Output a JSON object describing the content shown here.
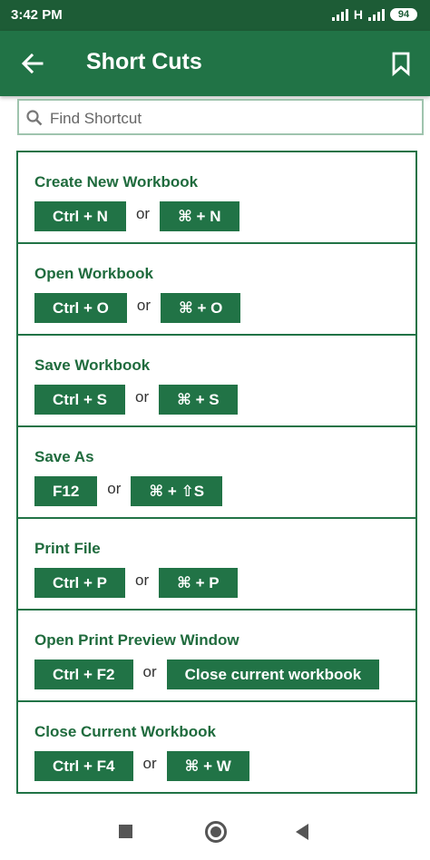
{
  "status": {
    "time": "3:42 PM",
    "network": "H",
    "battery": "94"
  },
  "header": {
    "title": "Short Cuts"
  },
  "search": {
    "placeholder": "Find Shortcut",
    "value": ""
  },
  "or_label": "or",
  "shortcuts": [
    {
      "label": "Create New Workbook",
      "keys": [
        "Ctrl + N",
        "⌘ + N"
      ]
    },
    {
      "label": "Open Workbook",
      "keys": [
        "Ctrl + O",
        "⌘ + O"
      ]
    },
    {
      "label": "Save Workbook",
      "keys": [
        "Ctrl + S",
        "⌘ + S"
      ]
    },
    {
      "label": "Save As",
      "keys": [
        "F12",
        "⌘ + ⇧S"
      ]
    },
    {
      "label": "Print File",
      "keys": [
        "Ctrl + P",
        "⌘ + P"
      ]
    },
    {
      "label": "Open Print Preview Window",
      "keys": [
        "Ctrl + F2",
        "Close current workbook"
      ]
    },
    {
      "label": "Close Current Workbook",
      "keys": [
        "Ctrl + F4",
        "⌘ + W"
      ]
    }
  ],
  "colors": {
    "primary": "#217346",
    "status_bar": "#1d5c36",
    "label_text": "#1f6b3d"
  },
  "icons": {
    "back": "arrow-left-icon",
    "bookmark": "bookmark-icon",
    "search": "search-icon"
  }
}
